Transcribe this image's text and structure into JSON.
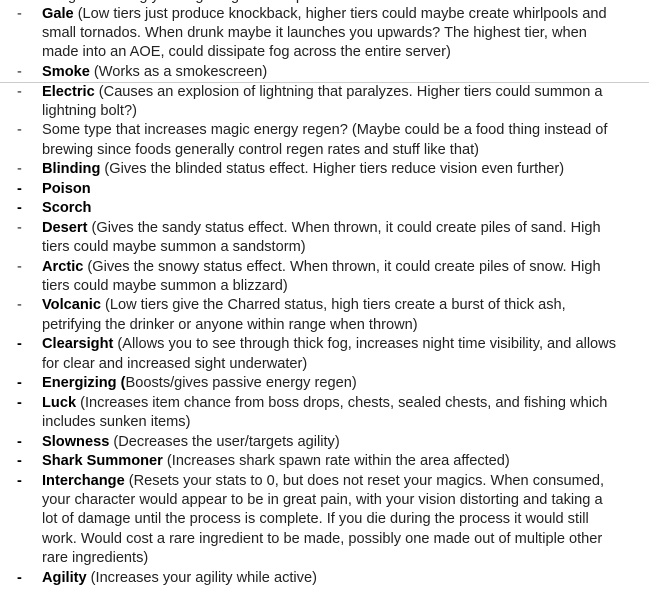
{
  "document": {
    "clipped_top_line": "…ing something you’re getting at the top …",
    "section_a": [
      {
        "label": "Gale",
        "desc": " (Low tiers just produce knockback, higher tiers could maybe create whirlpools and small tornados. When drunk maybe it launches you upwards? The highest tier, when made into an AOE, could dissipate fog across the entire server)",
        "dash": "-",
        "dash_bold": false
      },
      {
        "label": "Smoke",
        "desc": " (Works as a smokescreen)",
        "dash": "-",
        "dash_bold": false
      }
    ],
    "section_b": [
      {
        "label": "Electric",
        "desc": " (Causes an explosion of lightning that paralyzes. Higher tiers could summon a lightning bolt?)",
        "dash": "-",
        "dash_bold": false
      },
      {
        "label": "",
        "desc": "Some type that increases magic energy regen? (Maybe could be a food thing instead of brewing since foods generally control regen rates and stuff like that)",
        "dash": "-",
        "dash_bold": false
      },
      {
        "label": "Blinding",
        "desc": " (Gives the blinded status effect. Higher tiers reduce vision even further)",
        "dash": "-",
        "dash_bold": false
      },
      {
        "label": "Poison",
        "desc": "",
        "dash": "-",
        "dash_bold": true
      },
      {
        "label": "Scorch",
        "desc": "",
        "dash": "-",
        "dash_bold": true
      },
      {
        "label": "Desert",
        "desc": " (Gives the sandy status effect. When thrown, it could create piles of sand. High tiers could maybe summon a sandstorm)",
        "dash": "-",
        "dash_bold": false
      },
      {
        "label": "Arctic",
        "desc": " (Gives the snowy status effect. When thrown, it could create piles of snow. High tiers could maybe summon a blizzard)",
        "dash": "-",
        "dash_bold": false
      },
      {
        "label": "Volcanic",
        "desc": " (Low tiers give the Charred status, high tiers create a burst of thick ash, petrifying the drinker or anyone within range when thrown)",
        "dash": "-",
        "dash_bold": false
      },
      {
        "label": "Clearsight",
        "desc": " (Allows you to see through thick fog, increases night time visibility, and allows for clear and increased sight underwater)",
        "dash": "-",
        "dash_bold": true
      },
      {
        "label": "Energizing (",
        "desc": "Boosts/gives passive energy regen)",
        "dash": "-",
        "dash_bold": true
      },
      {
        "label": "Luck",
        "desc": " (Increases item chance from boss drops, chests, sealed chests, and fishing which includes sunken items)",
        "dash": "-",
        "dash_bold": true
      },
      {
        "label": "Slowness",
        "desc": " (Decreases the user/targets agility)",
        "dash": "-",
        "dash_bold": true
      },
      {
        "label": "Shark Summoner",
        "desc": " (Increases shark spawn rate within the area affected)",
        "dash": "-",
        "dash_bold": true
      },
      {
        "label": "Interchange",
        "desc": " (Resets your stats to 0, but does not reset your magics. When consumed, your character would appear to be in great pain, with your vision distorting and taking a lot of damage until the process is complete. If you die during the process it would still work. Would cost a rare ingredient to be made, possibly one made out of multiple other rare ingredients)",
        "dash": "-",
        "dash_bold": true
      },
      {
        "label": "Agility",
        "desc": " (Increases your agility while active)",
        "dash": "-",
        "dash_bold": true
      }
    ]
  }
}
